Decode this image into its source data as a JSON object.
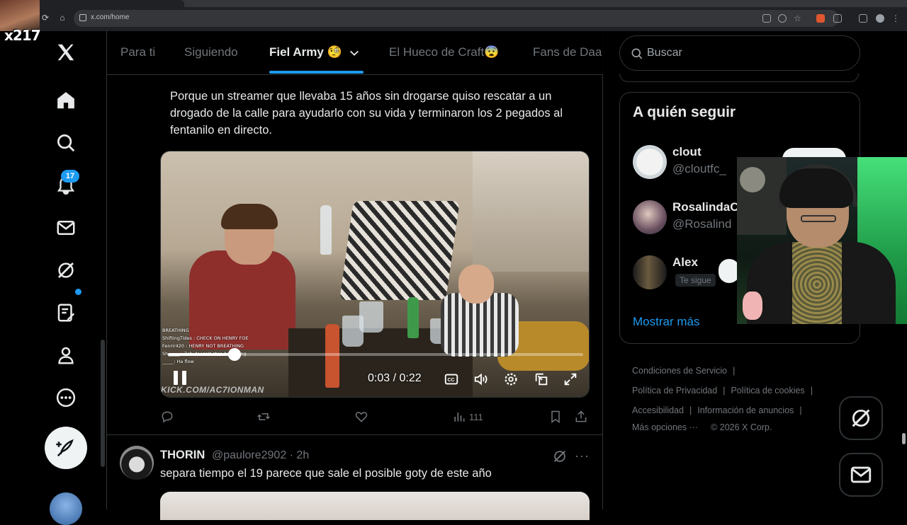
{
  "browser": {
    "url": "x.com/home"
  },
  "overlay": {
    "stream_tag": "x217"
  },
  "leftnav": {
    "notification_count": "17",
    "items": [
      "x-logo",
      "home",
      "explore",
      "notifications",
      "messages",
      "grok",
      "lists",
      "profile",
      "more"
    ]
  },
  "timeline": {
    "tabs": [
      "Para ti",
      "Siguiendo",
      "Fiel Army 🧐",
      "El Hueco de Craft😨",
      "Fans de Daa"
    ],
    "active_tab": "Fiel Army 🧐",
    "post": {
      "text": "Porque un streamer que llevaba 15 años sin drogarse quiso rescatar a un drogado de la calle para ayudarlo con su vida y terminaron los 2 pegados al fentanilo en directo.",
      "video": {
        "chat_lines": [
          "BREATHING",
          "ShiftingTides : CHECK ON HENRY FOE",
          "Fenrir420 : HENRY NOT BREATHING",
          "Sh_____ : 7oh doesn't stop breathing",
          "_____: Ha flow"
        ],
        "watermark": "KICK.COM/AC7IONMAN",
        "time_current": "0:03",
        "time_total": "0:22",
        "time_display": "0:03 / 0:22",
        "progress": 0.16
      },
      "views": "111"
    },
    "reply": {
      "name": "THORIN",
      "handle_time": "@paulore2902 · 2h",
      "text": "separa tiempo el 19 parece que sale el posible goty de este año"
    }
  },
  "sidebar": {
    "search_placeholder": "Buscar",
    "who_to_follow_title": "A quién seguir",
    "suggestions": [
      {
        "name": "clout",
        "handle": "@cloutfc_"
      },
      {
        "name": "RosalindaC",
        "handle": "@Rosalind"
      },
      {
        "name": "Alex",
        "badge": "Te sigue"
      }
    ],
    "show_more": "Mostrar más",
    "footer": {
      "terms": "Condiciones de Servicio",
      "privacy": "Política de Privacidad",
      "cookies": "Política de cookies",
      "accessibility": "Accesibilidad",
      "ads_info": "Información de anuncios",
      "more": "Más opciones ···",
      "copyright": "© 2026 X Corp."
    }
  },
  "colors": {
    "accent": "#1d9bf0",
    "background": "#000000",
    "text": "#e7e9ea",
    "muted": "#71767b",
    "border": "#2f3336"
  }
}
